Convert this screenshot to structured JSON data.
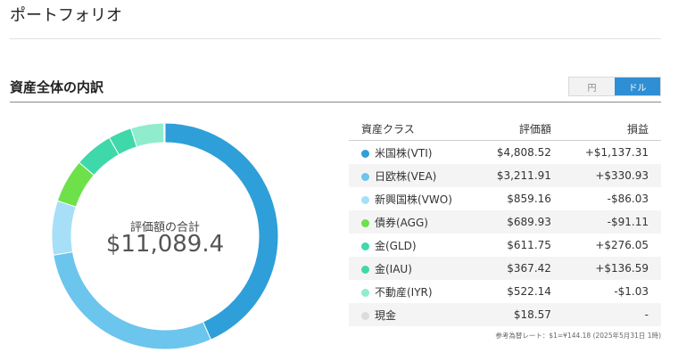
{
  "page_title": "ポートフォリオ",
  "section_title": "資産全体の内訳",
  "currency_toggle": {
    "options": [
      "円",
      "ドル"
    ],
    "selected": "ドル"
  },
  "summary": {
    "label": "評価額の合計",
    "value": "$11,089.4"
  },
  "table": {
    "headers": {
      "asset": "資産クラス",
      "value": "評価額",
      "pl": "損益"
    },
    "rows": [
      {
        "name": "米国株(VTI)",
        "value": "$4,808.52",
        "pl": "+$1,137.31",
        "pl_sign": "pos",
        "color": "#2e9fd9",
        "amount": 4808.52
      },
      {
        "name": "日欧株(VEA)",
        "value": "$3,211.91",
        "pl": "+$330.93",
        "pl_sign": "pos",
        "color": "#6cc5ec",
        "amount": 3211.91
      },
      {
        "name": "新興国株(VWO)",
        "value": "$859.16",
        "pl": "-$86.03",
        "pl_sign": "neg",
        "color": "#a6dff7",
        "amount": 859.16
      },
      {
        "name": "債券(AGG)",
        "value": "$689.93",
        "pl": "-$91.11",
        "pl_sign": "neg",
        "color": "#6ee04a",
        "amount": 689.93
      },
      {
        "name": "金(GLD)",
        "value": "$611.75",
        "pl": "+$276.05",
        "pl_sign": "pos",
        "color": "#3fd8aa",
        "amount": 611.75
      },
      {
        "name": "金(IAU)",
        "value": "$367.42",
        "pl": "+$136.59",
        "pl_sign": "pos",
        "color": "#3fd8aa",
        "amount": 367.42
      },
      {
        "name": "不動産(IYR)",
        "value": "$522.14",
        "pl": "-$1.03",
        "pl_sign": "neg",
        "color": "#8feccc",
        "amount": 522.14
      },
      {
        "name": "現金",
        "value": "$18.57",
        "pl": "-",
        "pl_sign": "neu",
        "color": "#dcdcdc",
        "amount": 18.57
      }
    ]
  },
  "exchange_note": "参考為替レート：$1=¥144.18 (2025年5月31日 1時)"
}
